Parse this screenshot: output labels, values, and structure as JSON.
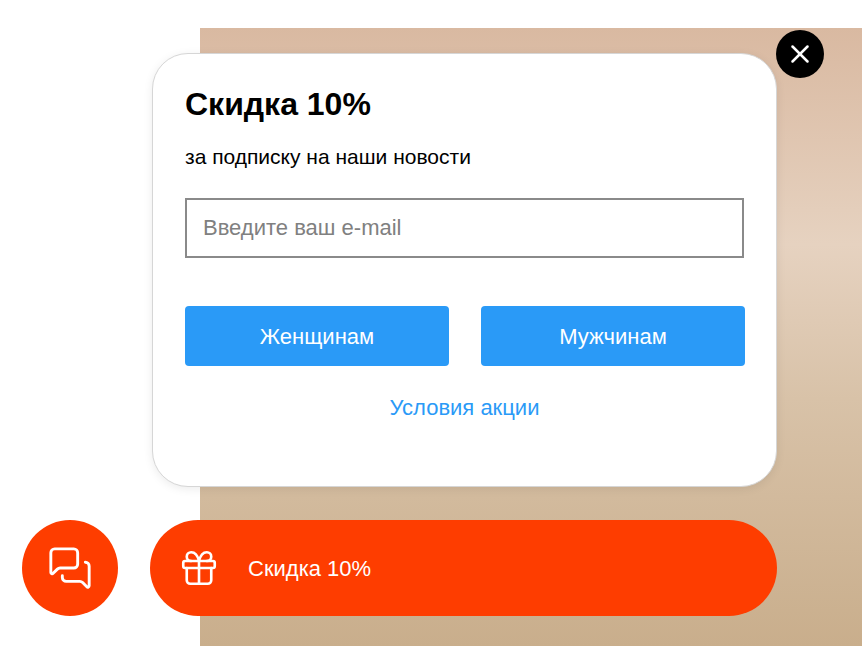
{
  "popup": {
    "title": "Скидка 10%",
    "subtitle": "за подписку на наши новости",
    "email": {
      "placeholder": "Введите ваш e-mail",
      "value": ""
    },
    "buttons": [
      "Женщинам",
      "Мужчинам"
    ],
    "terms_link": "Условия акции"
  },
  "discount_bar": {
    "label": "Скидка 10%"
  }
}
